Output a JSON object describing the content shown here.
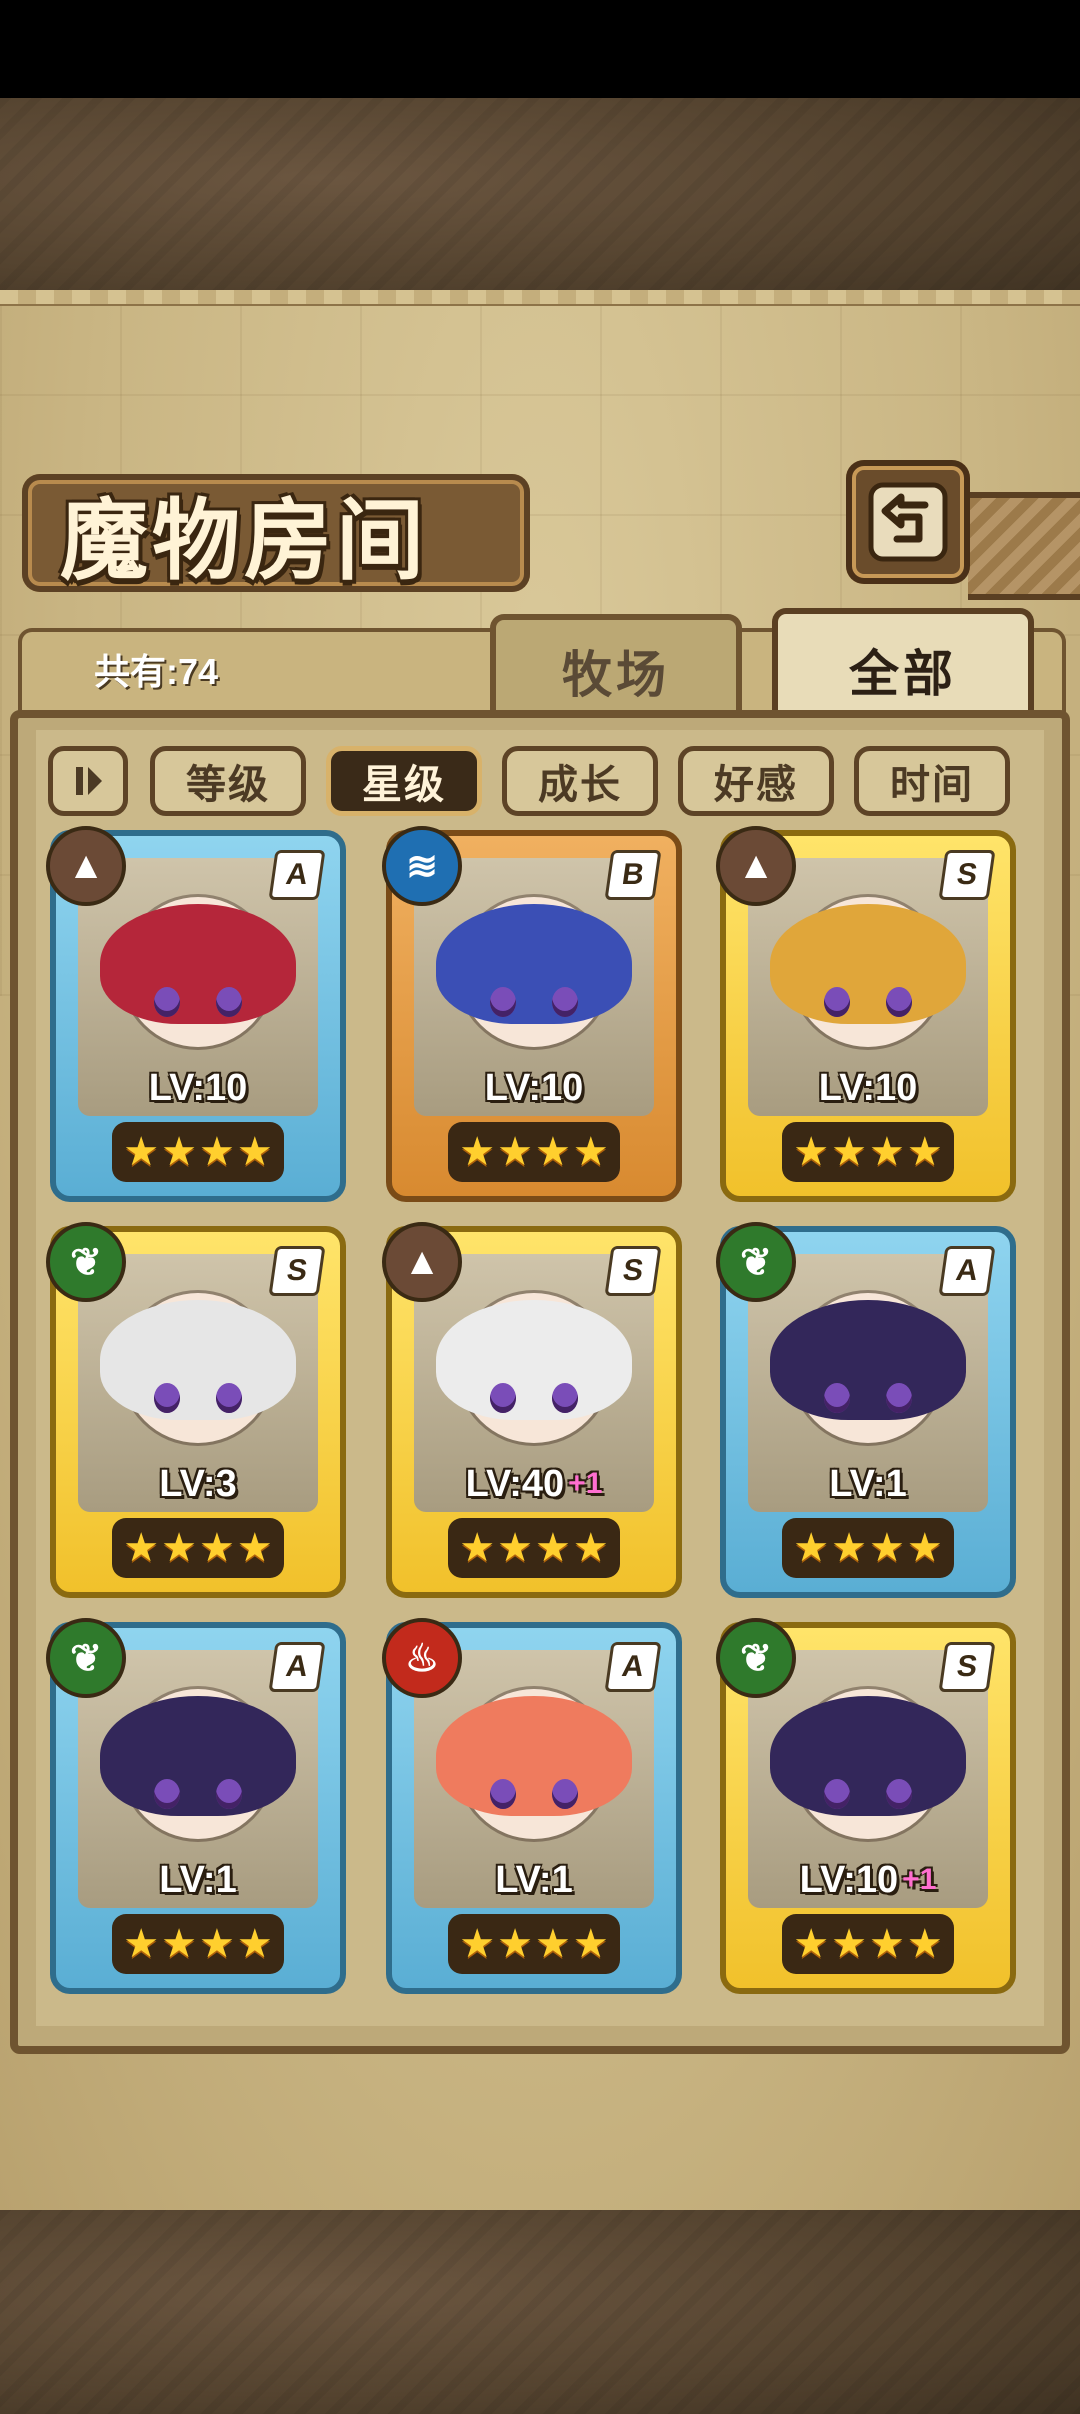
{
  "screen": {
    "title": "魔物房间",
    "total_label": "共有:74",
    "tabs": [
      {
        "label": "牧场",
        "active": false
      },
      {
        "label": "全部",
        "active": true
      }
    ],
    "sort_buttons": [
      {
        "label": "等级",
        "active": false
      },
      {
        "label": "星级",
        "active": true
      },
      {
        "label": "成长",
        "active": false
      },
      {
        "label": "好感",
        "active": false
      },
      {
        "label": "时间",
        "active": false
      }
    ],
    "icons": {
      "back": "back-arrow-icon",
      "sort_toggle": "sort-order-toggle-icon",
      "star": "star-icon"
    }
  },
  "monsters": [
    {
      "rank": "A",
      "element": "earth",
      "level": "LV:10",
      "level_bonus": "",
      "stars": 4,
      "hair": "#b5263a"
    },
    {
      "rank": "B",
      "element": "water",
      "level": "LV:10",
      "level_bonus": "",
      "stars": 4,
      "hair": "#3b4fb5"
    },
    {
      "rank": "S",
      "element": "earth",
      "level": "LV:10",
      "level_bonus": "",
      "stars": 4,
      "hair": "#e0a63a"
    },
    {
      "rank": "S",
      "element": "plant",
      "level": "LV:3",
      "level_bonus": "",
      "stars": 4,
      "hair": "#e6e6e6"
    },
    {
      "rank": "S",
      "element": "earth",
      "level": "LV:40",
      "level_bonus": "+1",
      "stars": 4,
      "hair": "#ececec"
    },
    {
      "rank": "A",
      "element": "plant",
      "level": "LV:1",
      "level_bonus": "",
      "stars": 4,
      "hair": "#33275a"
    },
    {
      "rank": "A",
      "element": "plant",
      "level": "LV:1",
      "level_bonus": "",
      "stars": 4,
      "hair": "#33275a"
    },
    {
      "rank": "A",
      "element": "fire",
      "level": "LV:1",
      "level_bonus": "",
      "stars": 4,
      "hair": "#ef7b5e"
    },
    {
      "rank": "S",
      "element": "plant",
      "level": "LV:10",
      "level_bonus": "+1",
      "stars": 4,
      "hair": "#33275a"
    }
  ]
}
